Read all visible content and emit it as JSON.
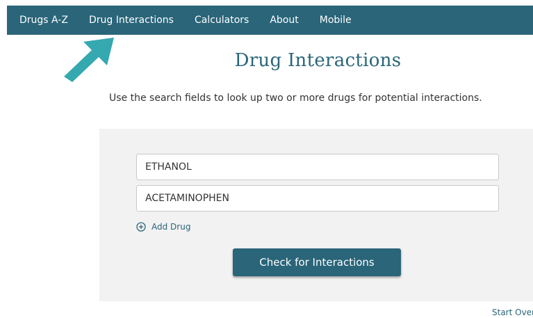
{
  "nav": {
    "items": [
      {
        "label": "Drugs A-Z"
      },
      {
        "label": "Drug Interactions"
      },
      {
        "label": "Calculators"
      },
      {
        "label": "About"
      },
      {
        "label": "Mobile"
      }
    ]
  },
  "page": {
    "title": "Drug Interactions",
    "subtitle": "Use the search fields to look up two or more drugs for potential interactions."
  },
  "form": {
    "drugs": [
      {
        "value": "ETHANOL"
      },
      {
        "value": "ACETAMINOPHEN"
      }
    ],
    "add_drug_label": "Add Drug",
    "check_button_label": "Check for Interactions"
  },
  "footer": {
    "start_over_label": "Start Over"
  },
  "colors": {
    "brand": "#2a6579",
    "arrow": "#35a8b0",
    "panel": "#f2f2f2"
  },
  "icons": {
    "pointer_arrow": "arrow-icon",
    "add": "plus-circle-icon"
  }
}
